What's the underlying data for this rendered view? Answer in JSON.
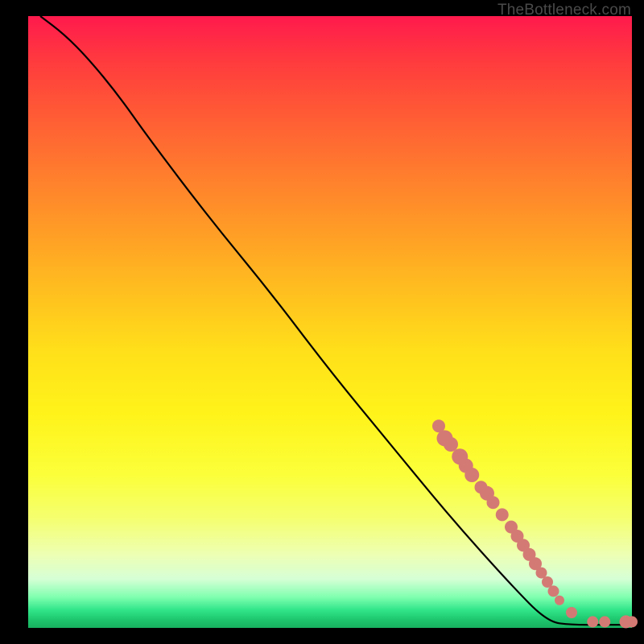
{
  "attribution": "TheBottleneck.com",
  "chart_data": {
    "type": "line",
    "title": "",
    "xlabel": "",
    "ylabel": "",
    "xlim": [
      0,
      100
    ],
    "ylim": [
      0,
      100
    ],
    "curve": [
      {
        "x": 2,
        "y": 100
      },
      {
        "x": 6,
        "y": 97
      },
      {
        "x": 10,
        "y": 93
      },
      {
        "x": 15,
        "y": 87
      },
      {
        "x": 20,
        "y": 80
      },
      {
        "x": 30,
        "y": 67
      },
      {
        "x": 40,
        "y": 55
      },
      {
        "x": 50,
        "y": 42
      },
      {
        "x": 60,
        "y": 30
      },
      {
        "x": 70,
        "y": 18
      },
      {
        "x": 80,
        "y": 7
      },
      {
        "x": 86,
        "y": 1
      },
      {
        "x": 90,
        "y": 0.5
      },
      {
        "x": 95,
        "y": 0.5
      },
      {
        "x": 100,
        "y": 0.5
      }
    ],
    "markers": [
      {
        "x": 68,
        "y": 33,
        "r": 8
      },
      {
        "x": 69,
        "y": 31,
        "r": 10
      },
      {
        "x": 70,
        "y": 30,
        "r": 9
      },
      {
        "x": 71.5,
        "y": 28,
        "r": 10
      },
      {
        "x": 72.5,
        "y": 26.5,
        "r": 9
      },
      {
        "x": 73.5,
        "y": 25,
        "r": 9
      },
      {
        "x": 75,
        "y": 23,
        "r": 8
      },
      {
        "x": 76,
        "y": 22,
        "r": 9
      },
      {
        "x": 77,
        "y": 20.5,
        "r": 8
      },
      {
        "x": 78.5,
        "y": 18.5,
        "r": 8
      },
      {
        "x": 80,
        "y": 16.5,
        "r": 8
      },
      {
        "x": 81,
        "y": 15,
        "r": 8
      },
      {
        "x": 82,
        "y": 13.5,
        "r": 8
      },
      {
        "x": 83,
        "y": 12,
        "r": 8
      },
      {
        "x": 84,
        "y": 10.5,
        "r": 8
      },
      {
        "x": 85,
        "y": 9,
        "r": 7
      },
      {
        "x": 86,
        "y": 7.5,
        "r": 7
      },
      {
        "x": 87,
        "y": 6,
        "r": 7
      },
      {
        "x": 88,
        "y": 4.5,
        "r": 6
      },
      {
        "x": 90,
        "y": 2.5,
        "r": 7
      },
      {
        "x": 93.5,
        "y": 1,
        "r": 7
      },
      {
        "x": 95.5,
        "y": 1,
        "r": 7
      },
      {
        "x": 99,
        "y": 1,
        "r": 8
      },
      {
        "x": 100,
        "y": 1,
        "r": 7
      }
    ]
  }
}
